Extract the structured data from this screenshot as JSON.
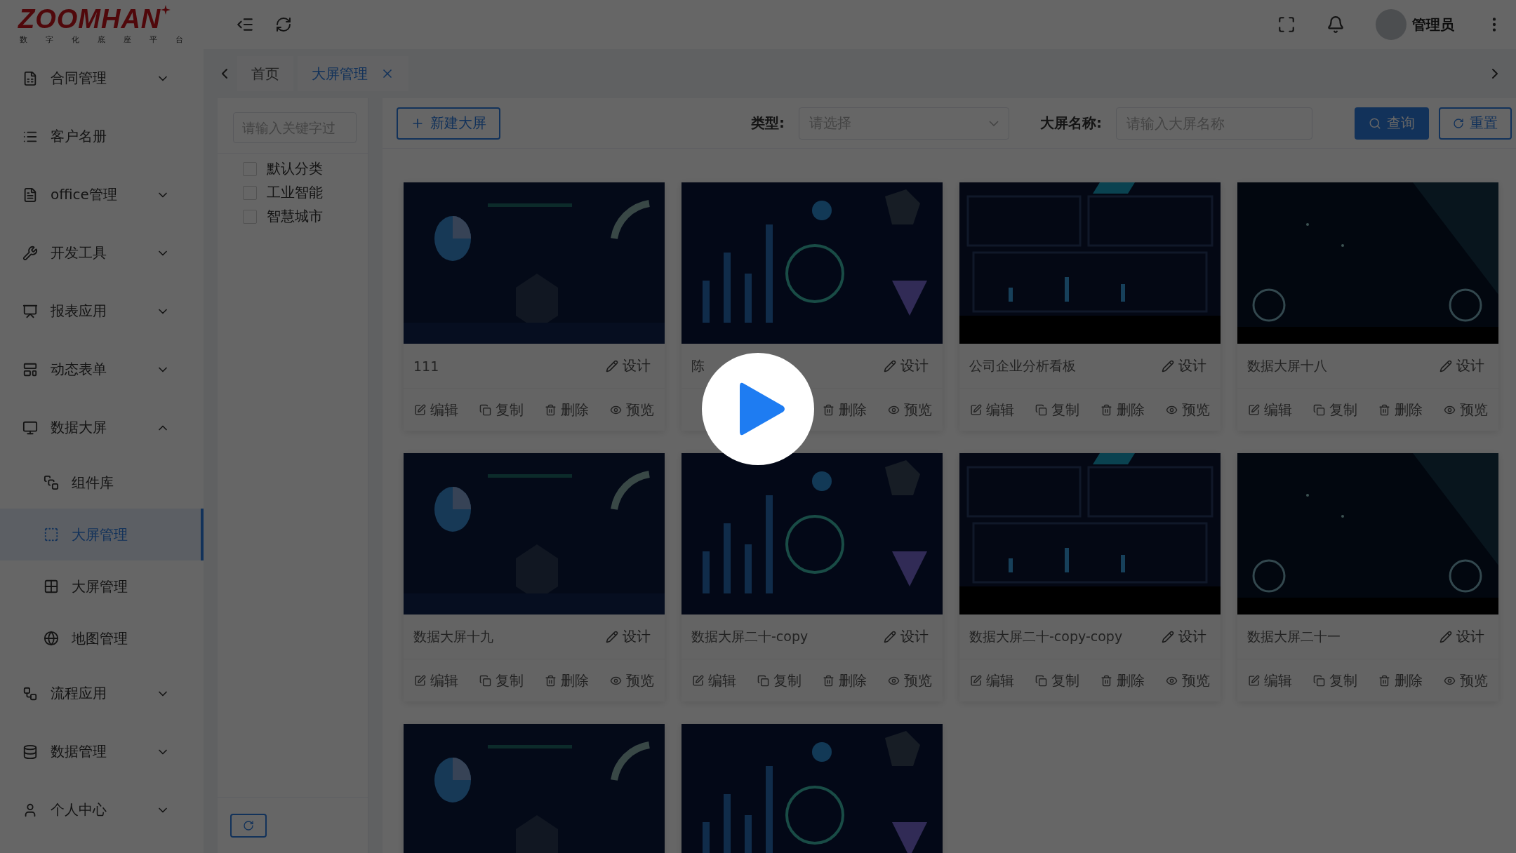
{
  "logo": {
    "brand": "ZOOMHAN",
    "tagline": [
      "数",
      "字",
      "化",
      "底",
      "座",
      "平",
      "台"
    ]
  },
  "header": {
    "user": "管理员"
  },
  "sidebar": {
    "items": [
      {
        "label": "合同管理",
        "expanded": false
      },
      {
        "label": "客户名册"
      },
      {
        "label": "office管理",
        "expanded": false
      },
      {
        "label": "开发工具",
        "expanded": false
      },
      {
        "label": "报表应用",
        "expanded": false
      },
      {
        "label": "动态表单",
        "expanded": false
      },
      {
        "label": "数据大屏",
        "expanded": true,
        "children": [
          {
            "label": "组件库",
            "selected": false
          },
          {
            "label": "大屏管理",
            "selected": true
          },
          {
            "label": "大屏管理",
            "selected": false
          },
          {
            "label": "地图管理",
            "selected": false
          }
        ]
      },
      {
        "label": "流程应用",
        "expanded": false
      },
      {
        "label": "数据管理",
        "expanded": false
      },
      {
        "label": "个人中心",
        "expanded": false
      }
    ]
  },
  "tabs": [
    {
      "label": "首页",
      "selected": false,
      "closable": false
    },
    {
      "label": "大屏管理",
      "selected": true,
      "closable": true
    }
  ],
  "filter_panel": {
    "placeholder": "请输入关键字过",
    "categories": [
      {
        "label": "默认分类",
        "checked": false
      },
      {
        "label": "工业智能",
        "checked": false
      },
      {
        "label": "智慧城市",
        "checked": false
      }
    ]
  },
  "toolbar": {
    "new_button": "新建大屏",
    "type_label": "类型:",
    "type_placeholder": "请选择",
    "name_label": "大屏名称:",
    "name_placeholder": "请输入大屏名称",
    "query_button": "查询",
    "reset_button": "重置"
  },
  "cards": [
    {
      "title": "111",
      "design": "设计",
      "actions": [
        {
          "kind": "edit",
          "label": "编辑"
        },
        {
          "kind": "copy",
          "label": "复制"
        },
        {
          "kind": "delete",
          "label": "删除"
        },
        {
          "kind": "preview",
          "label": "预览"
        }
      ]
    },
    {
      "title": "陈",
      "design": "设计",
      "actions": [
        {
          "kind": "delete",
          "label": "删除"
        },
        {
          "kind": "preview",
          "label": "预览"
        }
      ]
    },
    {
      "title": "公司企业分析看板",
      "design": "设计",
      "actions": [
        {
          "kind": "edit",
          "label": "编辑"
        },
        {
          "kind": "copy",
          "label": "复制"
        },
        {
          "kind": "delete",
          "label": "删除"
        },
        {
          "kind": "preview",
          "label": "预览"
        }
      ]
    },
    {
      "title": "数据大屏十八",
      "design": "设计",
      "actions": [
        {
          "kind": "edit",
          "label": "编辑"
        },
        {
          "kind": "copy",
          "label": "复制"
        },
        {
          "kind": "delete",
          "label": "删除"
        },
        {
          "kind": "preview",
          "label": "预览"
        }
      ]
    },
    {
      "title": "数据大屏十九",
      "design": "设计",
      "actions": [
        {
          "kind": "edit",
          "label": "编辑"
        },
        {
          "kind": "copy",
          "label": "复制"
        },
        {
          "kind": "delete",
          "label": "删除"
        },
        {
          "kind": "preview",
          "label": "预览"
        }
      ]
    },
    {
      "title": "数据大屏二十-copy",
      "design": "设计",
      "actions": [
        {
          "kind": "edit",
          "label": "编辑"
        },
        {
          "kind": "copy",
          "label": "复制"
        },
        {
          "kind": "delete",
          "label": "删除"
        },
        {
          "kind": "preview",
          "label": "预览"
        }
      ]
    },
    {
      "title": "数据大屏二十-copy-copy",
      "design": "设计",
      "actions": [
        {
          "kind": "edit",
          "label": "编辑"
        },
        {
          "kind": "copy",
          "label": "复制"
        },
        {
          "kind": "delete",
          "label": "删除"
        },
        {
          "kind": "preview",
          "label": "预览"
        }
      ]
    },
    {
      "title": "数据大屏二十一",
      "design": "设计",
      "actions": [
        {
          "kind": "edit",
          "label": "编辑"
        },
        {
          "kind": "copy",
          "label": "复制"
        },
        {
          "kind": "delete",
          "label": "删除"
        },
        {
          "kind": "preview",
          "label": "预览"
        }
      ]
    },
    {
      "kind": "picture"
    },
    {
      "kind": "picture"
    }
  ],
  "video_overlay": {
    "dimmed": true
  }
}
